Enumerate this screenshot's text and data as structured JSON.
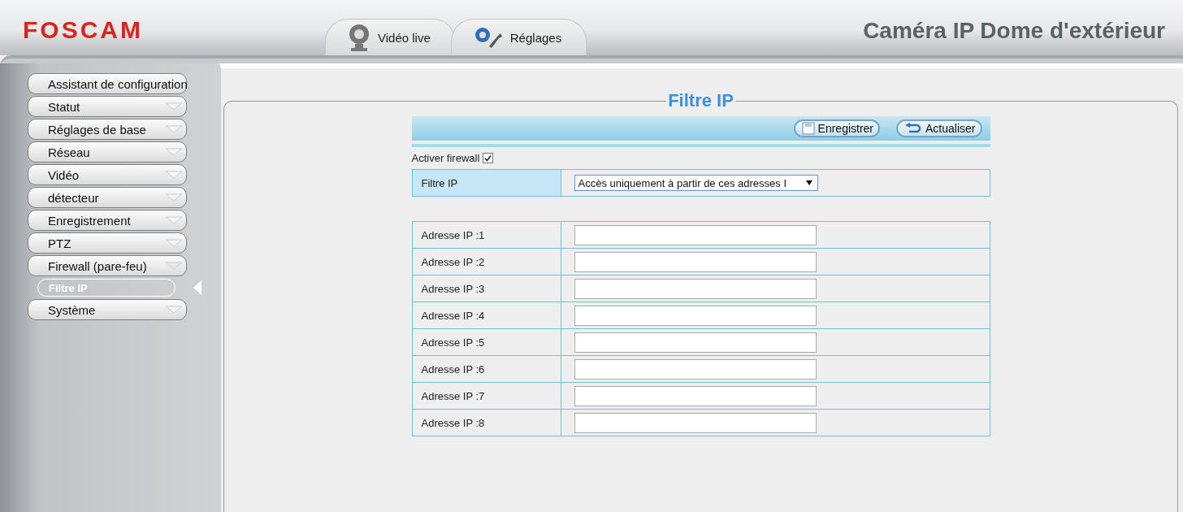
{
  "header": {
    "logo": "FOSCAM",
    "title": "Caméra IP Dome d'extérieur"
  },
  "tabs": [
    {
      "label": "Vidéo live",
      "kind": "webcam"
    },
    {
      "label": "Réglages",
      "kind": "gears"
    }
  ],
  "sidebar": {
    "items": [
      {
        "label": "Assistant de configuration",
        "kind": "link"
      },
      {
        "label": "Statut",
        "kind": "menu",
        "expanded": false
      },
      {
        "label": "Réglages de base",
        "kind": "menu",
        "expanded": false
      },
      {
        "label": "Réseau",
        "kind": "menu",
        "expanded": false
      },
      {
        "label": "Vidéo",
        "kind": "menu",
        "expanded": false
      },
      {
        "label": "détecteur",
        "kind": "menu",
        "expanded": false
      },
      {
        "label": "Enregistrement",
        "kind": "menu",
        "expanded": false
      },
      {
        "label": "PTZ",
        "kind": "menu",
        "expanded": false
      },
      {
        "label": "Firewall (pare-feu)",
        "kind": "menu",
        "expanded": true,
        "children": [
          {
            "label": "Filtre IP",
            "selected": true
          }
        ]
      },
      {
        "label": "Système",
        "kind": "menu",
        "expanded": false
      }
    ]
  },
  "panel": {
    "title": "Filtre IP",
    "toolbar": [
      {
        "label": "Enregistrer",
        "kind": "save"
      },
      {
        "label": "Actualiser",
        "kind": "refresh"
      }
    ],
    "firewall": {
      "label": "Activer firewall",
      "checked": true
    },
    "filter": {
      "label": "Filtre IP",
      "value": "Accès uniquement à partir de ces adresses I"
    },
    "addresses": [
      {
        "label": "Adresse IP :1"
      },
      {
        "label": "Adresse IP :2"
      },
      {
        "label": "Adresse IP :3"
      },
      {
        "label": "Adresse IP :4"
      },
      {
        "label": "Adresse IP :5"
      },
      {
        "label": "Adresse IP :6"
      },
      {
        "label": "Adresse IP :7"
      },
      {
        "label": "Adresse IP :8"
      }
    ]
  }
}
